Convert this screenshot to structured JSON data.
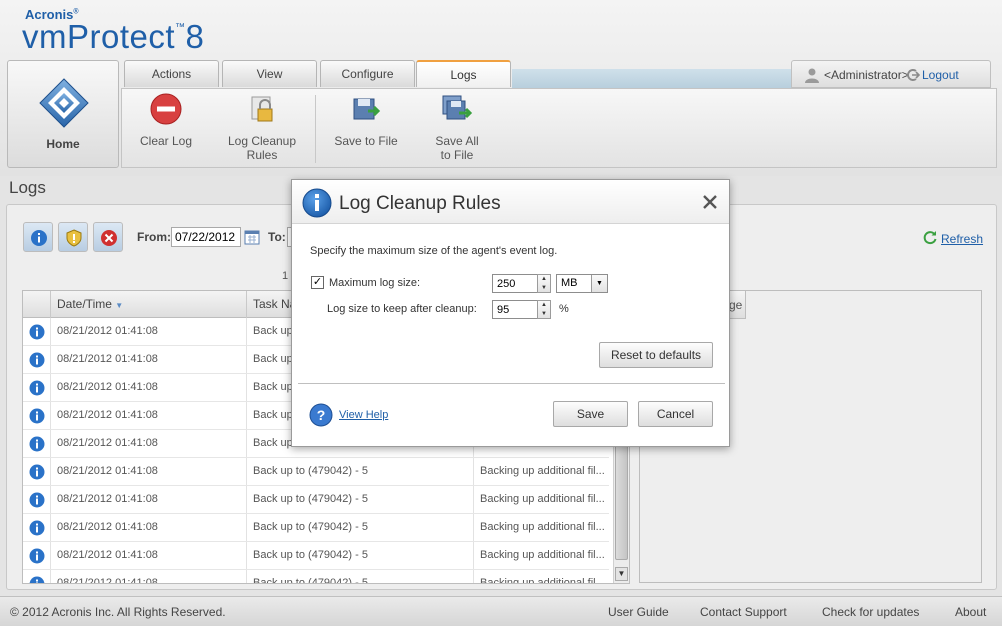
{
  "brand": {
    "company": "Acronis",
    "product_name": "vmProtect",
    "version": "8"
  },
  "home": {
    "label": "Home"
  },
  "tabs": [
    {
      "label": "Actions"
    },
    {
      "label": "View"
    },
    {
      "label": "Configure"
    },
    {
      "label": "Logs",
      "active": true
    }
  ],
  "ribbon": {
    "clear_log": [
      "Clear Log"
    ],
    "log_cleanup_rules": [
      "Log Cleanup",
      "Rules"
    ],
    "save_to_file": [
      "Save to File"
    ],
    "save_all_to_file": [
      "Save All",
      "to File"
    ]
  },
  "user": {
    "name": "<Administrator>",
    "logout_label": "Logout"
  },
  "page": {
    "title": "Logs"
  },
  "filters": {
    "from_label": "From:",
    "from_value": "07/22/2012",
    "to_label": "To:",
    "refresh_label": "Refresh",
    "page_number": "1"
  },
  "grid": {
    "columns": [
      "Date/Time",
      "Task Na"
    ],
    "rows": [
      {
        "date": "08/21/2012 01:41:08",
        "task": "Back up",
        "message": ""
      },
      {
        "date": "08/21/2012 01:41:08",
        "task": "Back up",
        "message": ""
      },
      {
        "date": "08/21/2012 01:41:08",
        "task": "Back up",
        "message": ""
      },
      {
        "date": "08/21/2012 01:41:08",
        "task": "Back up",
        "message": ""
      },
      {
        "date": "08/21/2012 01:41:08",
        "task": "Back up",
        "message": ""
      },
      {
        "date": "08/21/2012 01:41:08",
        "task": "Back up to (479042) - 5",
        "message": "Backing up additional fil..."
      },
      {
        "date": "08/21/2012 01:41:08",
        "task": "Back up to (479042) - 5",
        "message": "Backing up additional fil..."
      },
      {
        "date": "08/21/2012 01:41:08",
        "task": "Back up to (479042) - 5",
        "message": "Backing up additional fil..."
      },
      {
        "date": "08/21/2012 01:41:08",
        "task": "Back up to (479042) - 5",
        "message": "Backing up additional fil..."
      },
      {
        "date": "08/21/2012 01:41:08",
        "task": "Back up to (479042) - 5",
        "message": "Backing up additional fil..."
      }
    ]
  },
  "detail": {
    "tab_label": "ge"
  },
  "footer": {
    "copyright": "© 2012 Acronis Inc. All Rights Reserved.",
    "links": [
      "User Guide",
      "Contact Support",
      "Check for updates",
      "About"
    ]
  },
  "dialog": {
    "title": "Log Cleanup Rules",
    "description": "Specify the maximum size of the agent's event log.",
    "max_size_label": "Maximum log size:",
    "max_size_checked": true,
    "max_size_value": "250",
    "max_size_unit": "MB",
    "keep_label": "Log size to keep after cleanup:",
    "keep_value": "95",
    "keep_unit": "%",
    "reset_label": "Reset to defaults",
    "help_label": "View Help",
    "save_label": "Save",
    "cancel_label": "Cancel"
  },
  "colors": {
    "brand_blue": "#1f5fa8",
    "active_tab_accent": "#f0a040",
    "error_red": "#d03030",
    "info_blue": "#2a72c8"
  }
}
